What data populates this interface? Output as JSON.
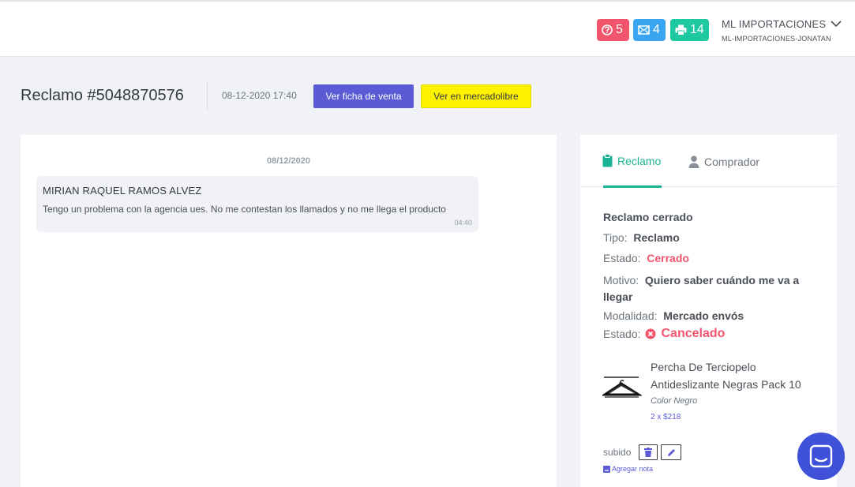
{
  "header": {
    "badges": [
      {
        "icon": "question-circle-icon",
        "count": "5",
        "color": "#f1556c"
      },
      {
        "icon": "envelope-icon",
        "count": "4",
        "color": "#39a5f0"
      },
      {
        "icon": "print-icon",
        "count": "14",
        "color": "#1ec8a0"
      }
    ],
    "user_name": "ML IMPORTACIONES",
    "user_account": "ML-IMPORTACIONES-JONATAN"
  },
  "page": {
    "title": "Reclamo #5048870576",
    "datetime": "08-12-2020 17:40",
    "btn_venta": "Ver ficha de venta",
    "btn_ml": "Ver en mercadolibre"
  },
  "chat": {
    "date": "08/12/2020",
    "messages": [
      {
        "author": "MIRIAN RAQUEL RAMOS ALVEZ",
        "text": "Tengo un problema con la agencia ues. No me contestan los llamados y no me llega el producto",
        "time": "04:40"
      }
    ]
  },
  "side": {
    "tabs": [
      {
        "label": "Reclamo",
        "icon": "clipboard-icon",
        "active": true
      },
      {
        "label": "Comprador",
        "icon": "user-icon",
        "active": false
      }
    ],
    "status_title": "Reclamo cerrado",
    "tipo_label": "Tipo:",
    "tipo_value": "Reclamo",
    "estado_label": "Estado:",
    "estado_value": "Cerrado",
    "motivo_label": "Motivo:",
    "motivo_value_1": "Quiero saber cuándo me va a",
    "motivo_value_2": "llegar",
    "modalidad_label": "Modalidad:",
    "modalidad_value": "Mercado envós",
    "estado2_label": "Estado:",
    "estado2_value": "Cancelado",
    "product": {
      "name": "Percha De Terciopelo Antideslizante Negras Pack 10",
      "variant": "Color Negro",
      "price": "2 x $218"
    },
    "subido_label": "subido",
    "nota_label": "Agregar nota"
  },
  "colors": {
    "accent": "#1ab394",
    "primary": "#5b5bd6",
    "danger": "#f1556c",
    "mercadolibre": "#fff200"
  }
}
